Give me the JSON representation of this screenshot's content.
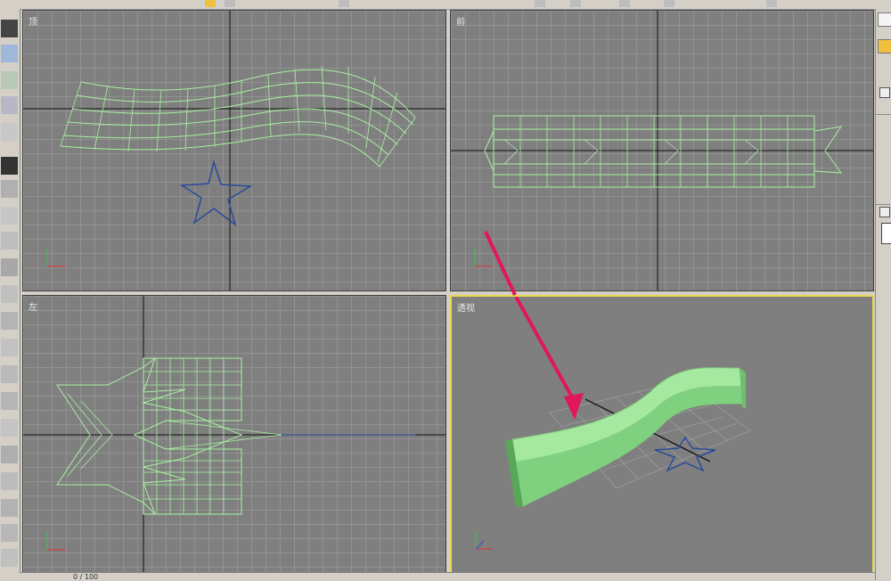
{
  "viewports": {
    "top": {
      "label": "顶"
    },
    "front": {
      "label": "前"
    },
    "left": {
      "label": "左"
    },
    "perspective": {
      "label": "透视"
    }
  },
  "axis": {
    "x": "x",
    "y": "y",
    "z": "z"
  },
  "statusbar": {
    "frame": "0 / 100"
  },
  "colors": {
    "viewport_bg": "#7f7f7f",
    "wireframe": "#a8f0a0",
    "star": "#2a4a9a",
    "active_border": "#e8d84a",
    "arrow": "#e0185a"
  },
  "icons": [
    "select-icon",
    "move-icon",
    "rotate-icon",
    "scale-icon",
    "create-icon",
    "modify-icon"
  ]
}
